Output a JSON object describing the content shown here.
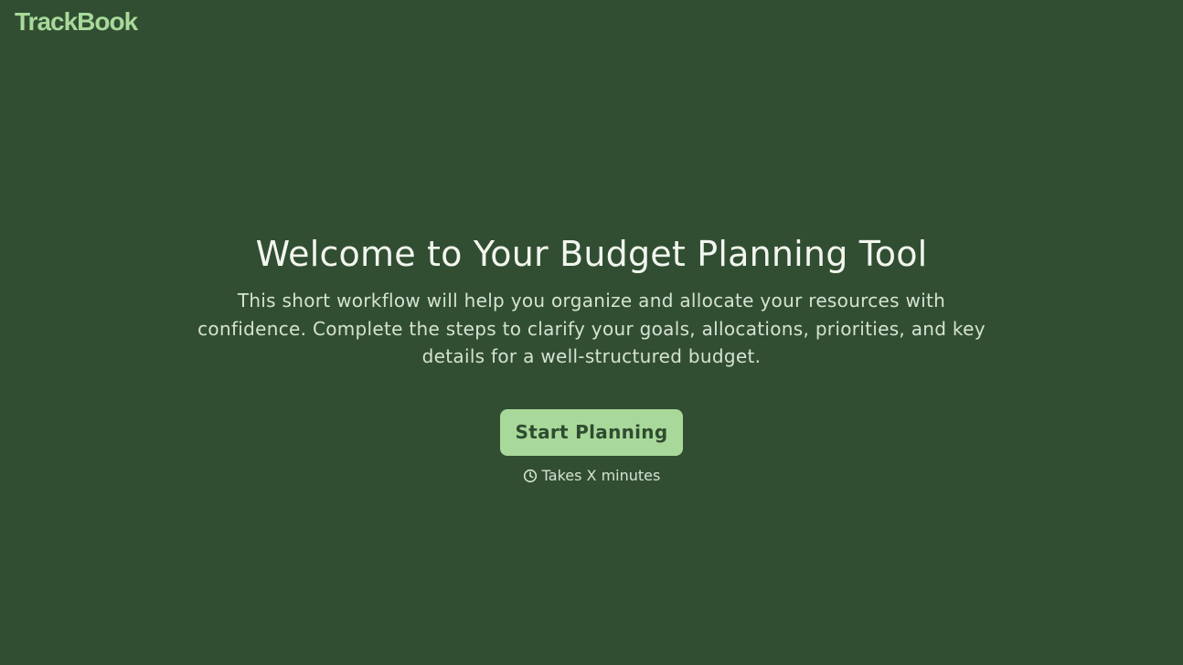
{
  "brand": {
    "name": "TrackBook"
  },
  "hero": {
    "title": "Welcome to Your Budget Planning Tool",
    "description": "This short workflow will help you organize and allocate your resources with confidence. Complete the steps to clarify your goals, allocations, priorities, and key details for a well-structured budget.",
    "button_label": "Start Planning",
    "duration_text": "Takes X minutes",
    "duration_icon": "clock-icon"
  },
  "colors": {
    "background": "#314e32",
    "accent": "#a8d99a",
    "title_text": "#f2f6ee",
    "body_text": "#d6e2d1",
    "button_text": "#2f4c31"
  }
}
